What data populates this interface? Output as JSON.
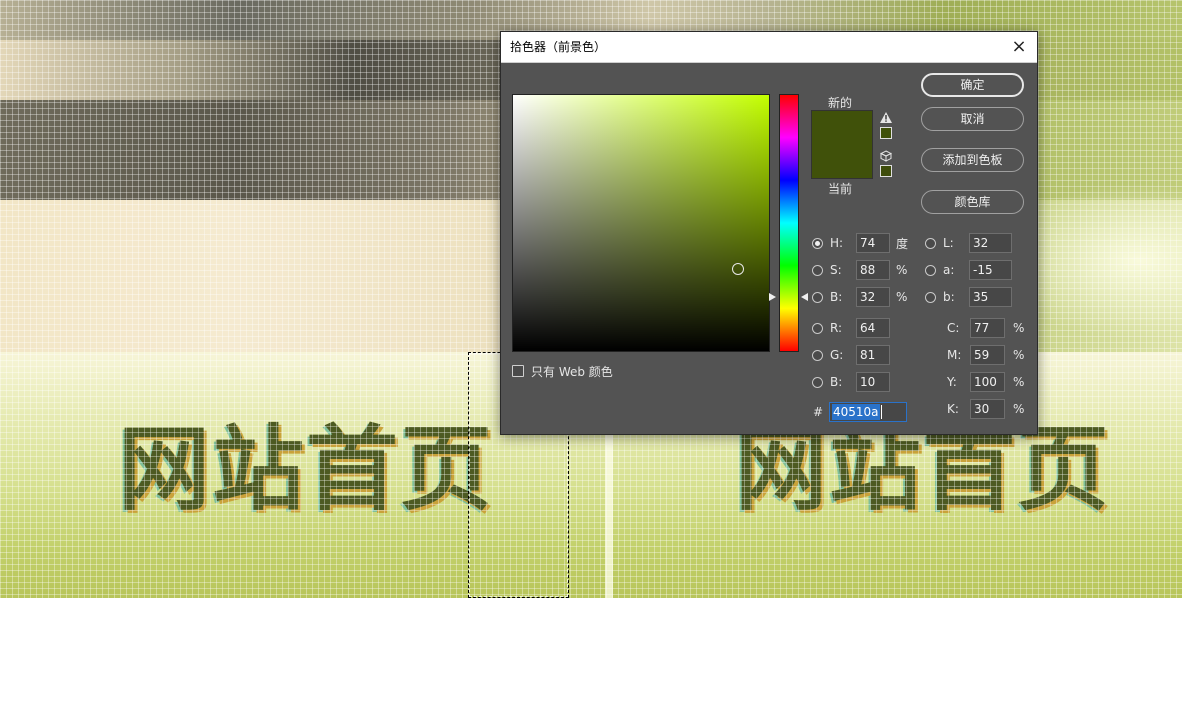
{
  "canvas": {
    "title_left": "网站首页",
    "title_right": "网站首页"
  },
  "dialog": {
    "title": "拾色器（前景色）",
    "close_icon": "×",
    "hue_degrees": 74,
    "label_new": "新的",
    "label_current": "当前",
    "new_color": "#40510a",
    "current_color": "#40510a",
    "web_only_label": "只有 Web 颜色",
    "buttons": {
      "ok": "确定",
      "cancel": "取消",
      "add_to_swatches": "添加到色板",
      "color_libraries": "颜色库"
    },
    "hsb": {
      "h_label": "H:",
      "h_value": "74",
      "h_unit": "度",
      "s_label": "S:",
      "s_value": "88",
      "s_unit": "%",
      "b_label": "B:",
      "b_value": "32",
      "b_unit": "%"
    },
    "lab": {
      "l_label": "L:",
      "l_value": "32",
      "a_label": "a:",
      "a_value": "-15",
      "b_label": "b:",
      "b_value": "35"
    },
    "rgb": {
      "r_label": "R:",
      "r_value": "64",
      "g_label": "G:",
      "g_value": "81",
      "b_label": "B:",
      "b_value": "10"
    },
    "cmyk": {
      "c_label": "C:",
      "c_value": "77",
      "c_unit": "%",
      "m_label": "M:",
      "m_value": "59",
      "m_unit": "%",
      "y_label": "Y:",
      "y_value": "100",
      "y_unit": "%",
      "k_label": "K:",
      "k_value": "30",
      "k_unit": "%"
    },
    "hex_label": "#",
    "hex_value": "40510a"
  }
}
